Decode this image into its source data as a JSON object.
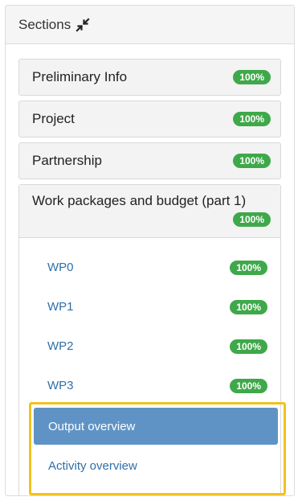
{
  "panel": {
    "title": "Sections",
    "collapse_icon": "collapse-arrows-icon"
  },
  "sections": [
    {
      "label": "Preliminary Info",
      "badge": "100%"
    },
    {
      "label": "Project",
      "badge": "100%"
    },
    {
      "label": "Partnership",
      "badge": "100%"
    },
    {
      "label": "Work packages and budget (part 1)",
      "badge": "100%"
    }
  ],
  "work_packages": [
    {
      "label": "WP0",
      "badge": "100%"
    },
    {
      "label": "WP1",
      "badge": "100%"
    },
    {
      "label": "WP2",
      "badge": "100%"
    },
    {
      "label": "WP3",
      "badge": "100%"
    }
  ],
  "overviews": {
    "output": "Output overview",
    "activity": "Activity overview"
  },
  "colors": {
    "badge_green": "#3fa84a",
    "link_blue": "#2f6fa8",
    "active_blue": "#5f93c5",
    "highlight_yellow": "#f2c21f"
  }
}
